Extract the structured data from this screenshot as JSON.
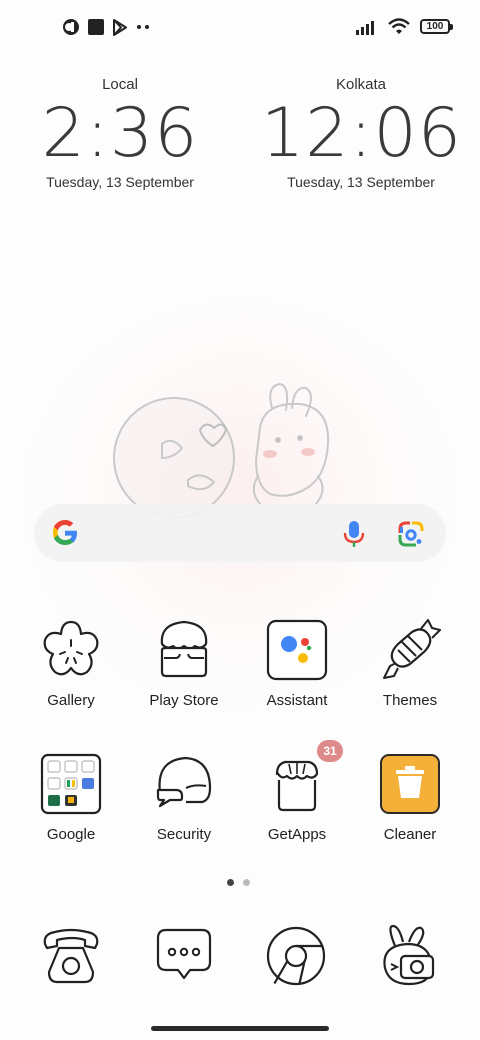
{
  "status_bar": {
    "left_icons": [
      "app-notification-icon",
      "square-notification-icon",
      "play-store-notification-icon",
      "more-notifications-icon"
    ],
    "right_icons": [
      "signal-icon",
      "wifi-icon",
      "battery-icon"
    ],
    "battery": "100"
  },
  "clocks": [
    {
      "city": "Local",
      "time": "2:36",
      "date": "Tuesday, 13 September"
    },
    {
      "city": "Kolkata",
      "time": "12:06",
      "date": "Tuesday, 13 September"
    }
  ],
  "search_bar": {
    "icons": [
      "google-g-icon",
      "microphone-icon",
      "google-lens-icon"
    ]
  },
  "apps": [
    {
      "label": "Gallery"
    },
    {
      "label": "Play Store"
    },
    {
      "label": "Assistant"
    },
    {
      "label": "Themes"
    },
    {
      "label": "Google"
    },
    {
      "label": "Security"
    },
    {
      "label": "GetApps",
      "badge": "31"
    },
    {
      "label": "Cleaner"
    }
  ],
  "page_indicator": {
    "pages": 2,
    "current": 1
  },
  "dock": {
    "icons": [
      "phone-icon",
      "messages-icon",
      "chrome-icon",
      "camera-icon"
    ]
  },
  "colors": {
    "background": "#fdfdfd",
    "badge": "#de8a8a",
    "cleaner_tile": "#f3b13a"
  }
}
